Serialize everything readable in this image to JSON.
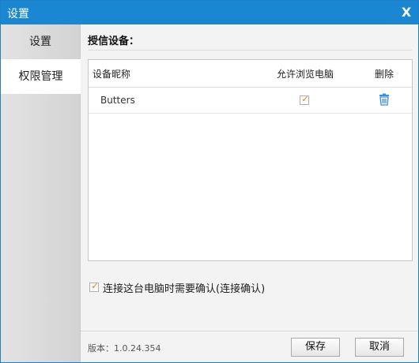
{
  "window": {
    "title": "设置",
    "close_label": "X"
  },
  "sidebar": {
    "items": [
      {
        "label": "设置"
      },
      {
        "label": "权限管理"
      }
    ]
  },
  "main": {
    "section_title": "授信设备：",
    "table": {
      "columns": [
        "设备昵称",
        "允许浏览电脑",
        "删除"
      ],
      "rows": [
        {
          "name": "Butters",
          "allow_browse": true
        }
      ]
    },
    "confirm_checkbox": {
      "checked": true,
      "label": "连接这台电脑时需要确认(连接确认)"
    },
    "version": "版本：1.0.24.354",
    "buttons": {
      "save": "保存",
      "cancel": "取消"
    }
  },
  "colors": {
    "titlebar": "#1b86d1",
    "checkmark": "#e07a10",
    "trash_icon": "#3d8fd8"
  },
  "icons": {
    "check": "checkmark-icon",
    "delete": "trash-icon",
    "close": "close-icon"
  }
}
